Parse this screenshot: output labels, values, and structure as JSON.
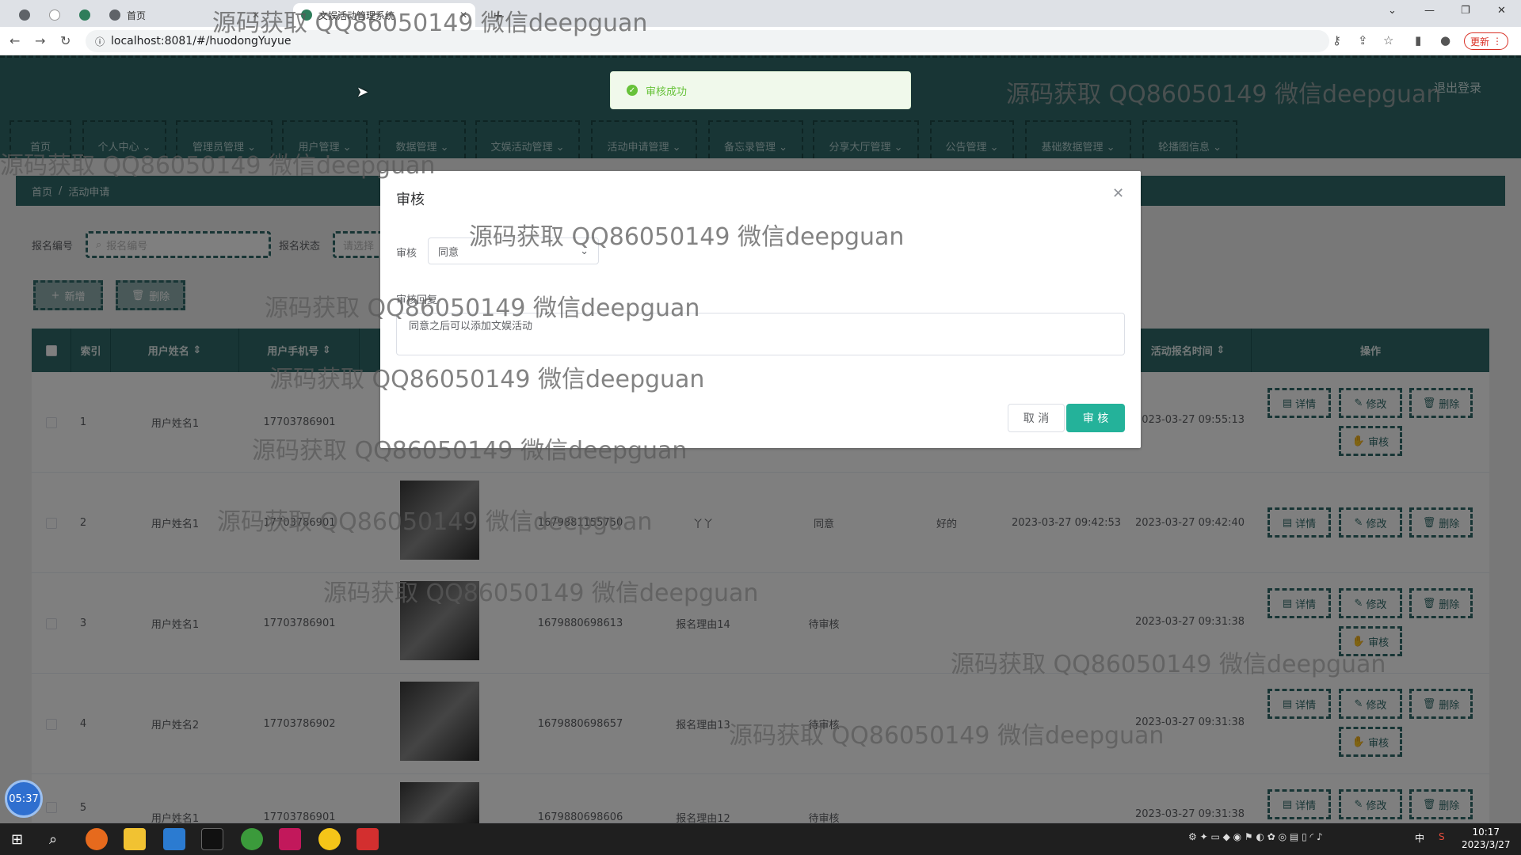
{
  "browser": {
    "tabs": [
      {
        "label": "首页"
      },
      {
        "label": "文娱活动管理系统"
      }
    ],
    "url": "localhost:8081/#/huodongYuyue",
    "update_label": "更新"
  },
  "header": {
    "logout_label": "退出登录"
  },
  "menu": [
    {
      "label": "首页"
    },
    {
      "label": "个人中心"
    },
    {
      "label": "管理员管理"
    },
    {
      "label": "用户管理"
    },
    {
      "label": "数据管理"
    },
    {
      "label": "文娱活动管理"
    },
    {
      "label": "活动申请管理"
    },
    {
      "label": "备忘录管理"
    },
    {
      "label": "分享大厅管理"
    },
    {
      "label": "公告管理"
    },
    {
      "label": "基础数据管理"
    },
    {
      "label": "轮播图信息"
    }
  ],
  "breadcrumb": {
    "home": "首页",
    "sep": "/",
    "current": "活动申请"
  },
  "search": {
    "field1_label": "报名编号",
    "field1_placeholder": "报名编号",
    "field2_label": "报名状态",
    "field2_placeholder": "请选择"
  },
  "actions": {
    "add_label": "新增",
    "delete_label": "删除"
  },
  "table": {
    "headers": [
      "索引",
      "用户姓名",
      "用户手机号",
      "活动报名时间",
      "操作"
    ],
    "rows": [
      {
        "index": "1",
        "name": "用户姓名1",
        "phone": "17703786901",
        "code": "",
        "reason": "",
        "status": "",
        "reply": "",
        "time1": "",
        "time2": "2023-03-27 09:55:13"
      },
      {
        "index": "2",
        "name": "用户姓名1",
        "phone": "17703786901",
        "code": "1679881155750",
        "reason": "丫丫",
        "status": "同意",
        "reply": "好的",
        "time1": "2023-03-27 09:42:53",
        "time2": "2023-03-27 09:42:40"
      },
      {
        "index": "3",
        "name": "用户姓名1",
        "phone": "17703786901",
        "code": "1679880698613",
        "reason": "报名理由14",
        "status": "待审核",
        "reply": "",
        "time1": "",
        "time2": "2023-03-27 09:31:38"
      },
      {
        "index": "4",
        "name": "用户姓名2",
        "phone": "17703786902",
        "code": "1679880698657",
        "reason": "报名理由13",
        "status": "待审核",
        "reply": "",
        "time1": "",
        "time2": "2023-03-27 09:31:38"
      },
      {
        "index": "5",
        "name": "用户姓名1",
        "phone": "17703786901",
        "code": "1679880698606",
        "reason": "报名理由12",
        "status": "待审核",
        "reply": "",
        "time1": "",
        "time2": "2023-03-27 09:31:38"
      }
    ],
    "op_labels": {
      "detail": "详情",
      "edit": "修改",
      "delete": "删除",
      "audit": "审核"
    }
  },
  "toast": {
    "message": "审核成功"
  },
  "dialog": {
    "title": "审核",
    "audit_label": "审核",
    "audit_value": "同意",
    "reply_label": "审核回复",
    "reply_value": "同意之后可以添加文娱活动",
    "cancel_label": "取 消",
    "confirm_label": "审 核"
  },
  "watermark": {
    "text": "源码获取 QQ86050149 微信deepguan"
  },
  "taskbar": {
    "time": "10:17",
    "date": "2023/3/27",
    "timer": "05:37",
    "ime": "中"
  },
  "colors": {
    "primary": "#306b6a",
    "accent": "#24b29a",
    "success": "#67c23a"
  }
}
